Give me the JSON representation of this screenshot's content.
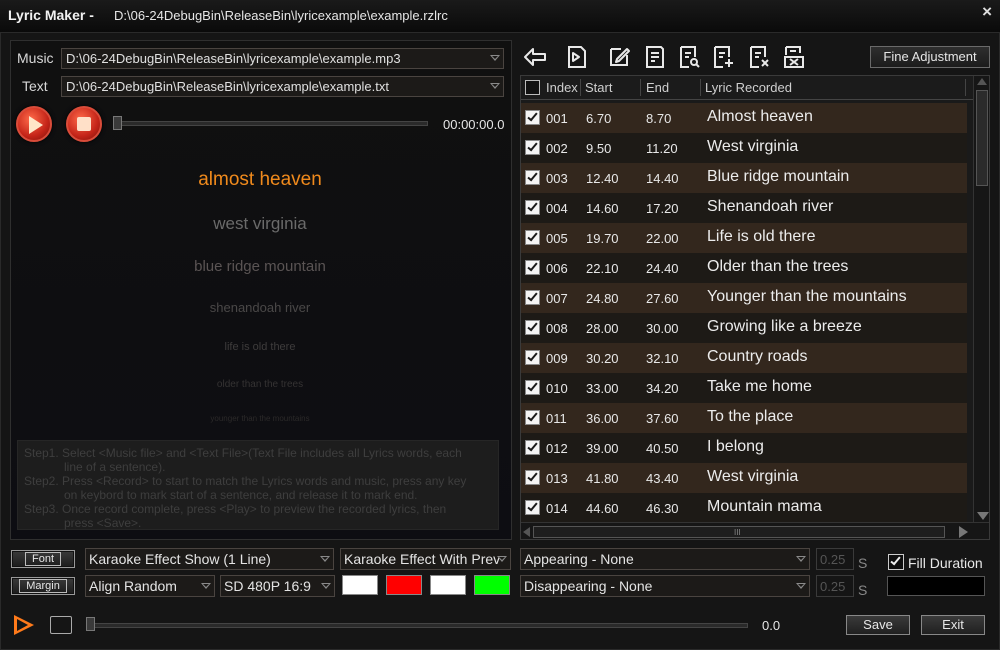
{
  "window": {
    "app_title": "Lyric Maker -",
    "file_path": "D:\\06-24DebugBin\\ReleaseBin\\lyricexample\\example.rzlrc",
    "close_glyph": "×"
  },
  "inputs": {
    "music_label": "Music",
    "music_path": "D:\\06-24DebugBin\\ReleaseBin\\lyricexample\\example.mp3",
    "text_label": "Text",
    "text_path": "D:\\06-24DebugBin\\ReleaseBin\\lyricexample\\example.txt"
  },
  "player": {
    "time": "00:00:00.0"
  },
  "preview": {
    "lines": [
      {
        "text": "almost heaven",
        "color": "#f08a1c"
      },
      {
        "text": "west virginia",
        "color": "#6a6a6a"
      },
      {
        "text": "blue ridge mountain",
        "color": "#5a5454"
      },
      {
        "text": "shenandoah river",
        "color": "#4a4848"
      },
      {
        "text": "life is old there",
        "color": "#3e3c3c"
      },
      {
        "text": "older than the trees",
        "color": "#353333"
      },
      {
        "text": "younger than the mountains",
        "color": "#2c2a2a"
      }
    ]
  },
  "instructions": {
    "step1": "Step1. Select <Music file> and <Text File>(Text File includes all Lyrics words, each",
    "step1b": "line of a sentence).",
    "step2": "Step2. Press <Record> to start to match the Lyrics words and music, press any key",
    "step2b": "on keybord to mark start of a sentence, and release it to mark end.",
    "step3": "Step3. Once record complete, press <Play> to preview the recorded lyrics, then",
    "step3b": "press <Save>."
  },
  "toolbar": {
    "icons": [
      "back-arrow-icon",
      "import-icon",
      "edit-icon",
      "document-icon",
      "document-search-icon",
      "document-add-icon",
      "document-delete-icon",
      "document-clear-icon"
    ],
    "fine_adjustment": "Fine Adjustment"
  },
  "table": {
    "headers": {
      "index": "Index",
      "start": "Start",
      "end": "End",
      "lyric": "Lyric Recorded"
    },
    "rows": [
      {
        "index": "001",
        "start": "6.70",
        "end": "8.70",
        "lyric": "Almost heaven",
        "checked": true
      },
      {
        "index": "002",
        "start": "9.50",
        "end": "11.20",
        "lyric": "West virginia",
        "checked": true
      },
      {
        "index": "003",
        "start": "12.40",
        "end": "14.40",
        "lyric": "Blue ridge mountain",
        "checked": true
      },
      {
        "index": "004",
        "start": "14.60",
        "end": "17.20",
        "lyric": "Shenandoah river",
        "checked": true
      },
      {
        "index": "005",
        "start": "19.70",
        "end": "22.00",
        "lyric": "Life is old there",
        "checked": true
      },
      {
        "index": "006",
        "start": "22.10",
        "end": "24.40",
        "lyric": "Older than the trees",
        "checked": true
      },
      {
        "index": "007",
        "start": "24.80",
        "end": "27.60",
        "lyric": "Younger than the mountains",
        "checked": true
      },
      {
        "index": "008",
        "start": "28.00",
        "end": "30.00",
        "lyric": "Growing like a breeze",
        "checked": true
      },
      {
        "index": "009",
        "start": "30.20",
        "end": "32.10",
        "lyric": "Country roads",
        "checked": true
      },
      {
        "index": "010",
        "start": "33.00",
        "end": "34.20",
        "lyric": "Take me home",
        "checked": true
      },
      {
        "index": "011",
        "start": "36.00",
        "end": "37.60",
        "lyric": "To the place",
        "checked": true
      },
      {
        "index": "012",
        "start": "39.00",
        "end": "40.50",
        "lyric": "I belong",
        "checked": true
      },
      {
        "index": "013",
        "start": "41.80",
        "end": "43.40",
        "lyric": "West virginia",
        "checked": true
      },
      {
        "index": "014",
        "start": "44.60",
        "end": "46.30",
        "lyric": "Mountain mama",
        "checked": true
      }
    ],
    "hscroll_grip": "III"
  },
  "settings": {
    "font_button": "Font",
    "margin_button": "Margin",
    "effect_show": "Karaoke Effect Show (1 Line)",
    "effect_preview": "Karaoke Effect With Prev",
    "align": "Align Random",
    "resolution": "SD 480P 16:9",
    "colors": [
      "#ffffff",
      "#ff0000",
      "#ffffff",
      "#00ff00"
    ],
    "appearing": "Appearing - None",
    "disappearing": "Disappearing - None",
    "appearing_seconds": "0.25",
    "disappearing_seconds": "0.25",
    "seconds_unit": "S",
    "fill_duration_label": "Fill Duration",
    "fill_duration_checked": true
  },
  "bottom": {
    "time": "0.0",
    "save": "Save",
    "exit": "Exit"
  }
}
